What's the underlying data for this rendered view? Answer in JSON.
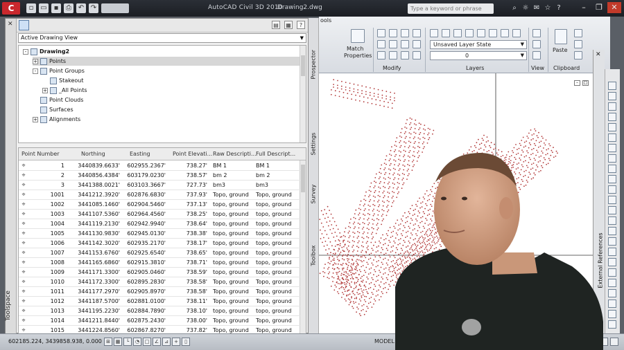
{
  "window": {
    "app_title": "AutoCAD Civil 3D 2010",
    "file_name": "Drawing2.dwg",
    "search_placeholder": "Type a keyword or phrase",
    "logo_letter": "C"
  },
  "toolspace": {
    "side_label": "Toolspace",
    "view_dropdown": "Active Drawing View",
    "tree": [
      {
        "label": "Drawing2",
        "level": 0,
        "expander": "-",
        "bold": true
      },
      {
        "label": "Points",
        "level": 1,
        "expander": "+",
        "selected": true
      },
      {
        "label": "Point Groups",
        "level": 1,
        "expander": "-"
      },
      {
        "label": "Stakeout",
        "level": 2,
        "expander": ""
      },
      {
        "label": "_All Points",
        "level": 2,
        "expander": "+"
      },
      {
        "label": "Point Clouds",
        "level": 1,
        "expander": ""
      },
      {
        "label": "Surfaces",
        "level": 1,
        "expander": ""
      },
      {
        "label": "Alignments",
        "level": 1,
        "expander": "+"
      }
    ],
    "columns": [
      "Point Number",
      "Northing",
      "Easting",
      "Point Elevati...",
      "Raw Descripti...",
      "Full Descript..."
    ],
    "rows": [
      {
        "num": "1",
        "north": "3440839.6633'",
        "east": "602955.2367'",
        "elev": "738.27'",
        "raw": "BM 1",
        "full": "BM 1"
      },
      {
        "num": "2",
        "north": "3440856.4384'",
        "east": "603179.0230'",
        "elev": "738.57'",
        "raw": "bm 2",
        "full": "bm 2"
      },
      {
        "num": "3",
        "north": "3441388.0021'",
        "east": "603103.3667'",
        "elev": "727.73'",
        "raw": "bm3",
        "full": "bm3"
      },
      {
        "num": "1001",
        "north": "3441212.3920'",
        "east": "602876.6830'",
        "elev": "737.93'",
        "raw": "Topo, ground",
        "full": "Topo, ground"
      },
      {
        "num": "1002",
        "north": "3441085.1460'",
        "east": "602904.5460'",
        "elev": "737.13'",
        "raw": "topo, ground",
        "full": "topo, ground"
      },
      {
        "num": "1003",
        "north": "3441107.5360'",
        "east": "602964.4560'",
        "elev": "738.25'",
        "raw": "topo, ground",
        "full": "topo, ground"
      },
      {
        "num": "1004",
        "north": "3441119.2130'",
        "east": "602942.9940'",
        "elev": "738.64'",
        "raw": "topo, ground",
        "full": "topo, ground"
      },
      {
        "num": "1005",
        "north": "3441130.9830'",
        "east": "602945.0130'",
        "elev": "738.38'",
        "raw": "topo, ground",
        "full": "topo, ground"
      },
      {
        "num": "1006",
        "north": "3441142.3020'",
        "east": "602935.2170'",
        "elev": "738.17'",
        "raw": "topo, ground",
        "full": "topo, ground"
      },
      {
        "num": "1007",
        "north": "3441153.6760'",
        "east": "602925.6540'",
        "elev": "738.65'",
        "raw": "topo, ground",
        "full": "topo, ground"
      },
      {
        "num": "1008",
        "north": "3441165.6860'",
        "east": "602915.3810'",
        "elev": "738.71'",
        "raw": "topo, ground",
        "full": "topo, ground"
      },
      {
        "num": "1009",
        "north": "3441171.3300'",
        "east": "602905.0460'",
        "elev": "738.59'",
        "raw": "topo, ground",
        "full": "topo, ground"
      },
      {
        "num": "1010",
        "north": "3441172.3300'",
        "east": "602895.2830'",
        "elev": "738.58'",
        "raw": "Topo, ground",
        "full": "Topo, ground"
      },
      {
        "num": "1011",
        "north": "3441177.2970'",
        "east": "602905.8970'",
        "elev": "738.58'",
        "raw": "Topo, ground",
        "full": "Topo, ground"
      },
      {
        "num": "1012",
        "north": "3441187.5700'",
        "east": "602881.0100'",
        "elev": "738.11'",
        "raw": "Topo, ground",
        "full": "Topo, ground"
      },
      {
        "num": "1013",
        "north": "3441195.2230'",
        "east": "602884.7890'",
        "elev": "738.10'",
        "raw": "topo, ground",
        "full": "topo, ground"
      },
      {
        "num": "1014",
        "north": "3441211.8440'",
        "east": "602875.2430'",
        "elev": "738.00'",
        "raw": "Topo, ground",
        "full": "Topo, ground"
      },
      {
        "num": "1015",
        "north": "3441224.8560'",
        "east": "602867.8270'",
        "elev": "737.82'",
        "raw": "Topo, ground",
        "full": "Topo, ground"
      }
    ]
  },
  "palette_tabs": [
    "Prospector",
    "Settings",
    "Survey",
    "Toolbox"
  ],
  "ribbon": {
    "tab_fragment": "ools",
    "match_label_1": "Match",
    "match_label_2": "Properties",
    "panels": [
      "Modify",
      "Layers",
      "View",
      "Clipboard"
    ],
    "layer_state": "Unsaved Layer State",
    "current_layer": "0",
    "paste_label": "Paste"
  },
  "right_panel": {
    "label": "External References"
  },
  "status": {
    "coords": "602185.224, 3439858.938, 0.000",
    "model_label": "MODEL"
  },
  "colors": {
    "points": "#b23a3a",
    "selection": "#d7d7d7",
    "close_button": "#c23a2a"
  }
}
